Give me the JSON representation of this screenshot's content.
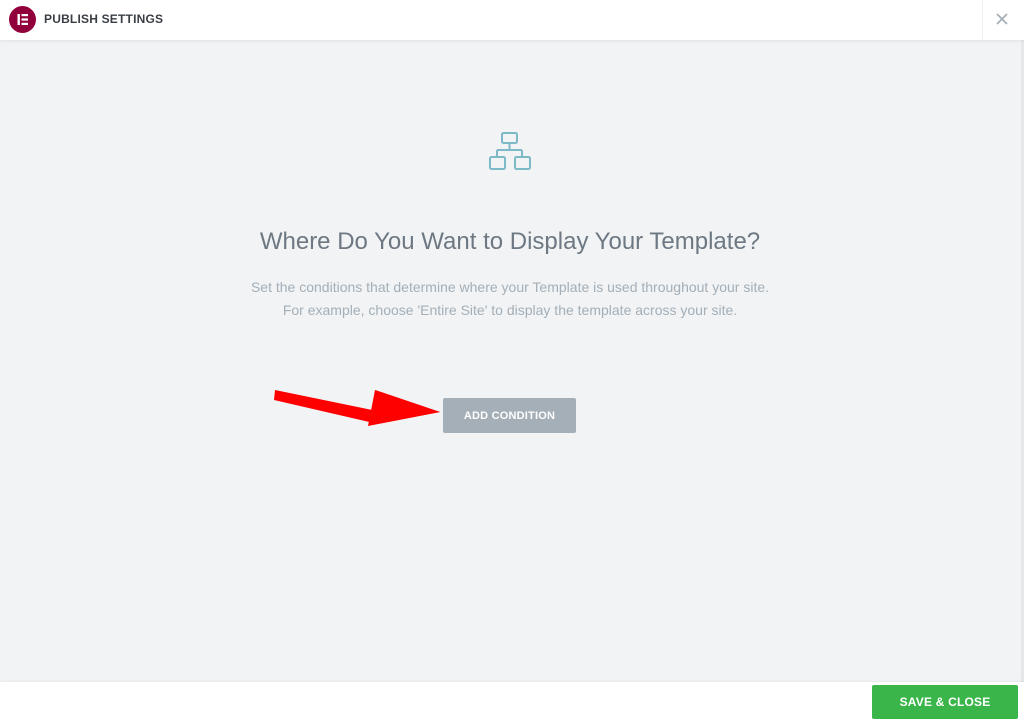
{
  "header": {
    "title": "PUBLISH SETTINGS",
    "logo_icon": "elementor-logo-icon",
    "close_icon": "close-icon"
  },
  "main": {
    "illustration_icon": "sitemap-hierarchy-icon",
    "heading": "Where Do You Want to Display Your Template?",
    "description_line1": "Set the conditions that determine where your Template is used throughout your site.",
    "description_line2": "For example, choose 'Entire Site' to display the template across your site.",
    "add_condition_label": "ADD CONDITION",
    "annotation_icon": "red-arrow-icon"
  },
  "footer": {
    "save_label": "SAVE & CLOSE"
  },
  "colors": {
    "brand": "#92003b",
    "save_green": "#39b54a",
    "muted_button": "#a4afb7",
    "arrow_red": "#ff0000",
    "background": "#f1f3f5"
  }
}
